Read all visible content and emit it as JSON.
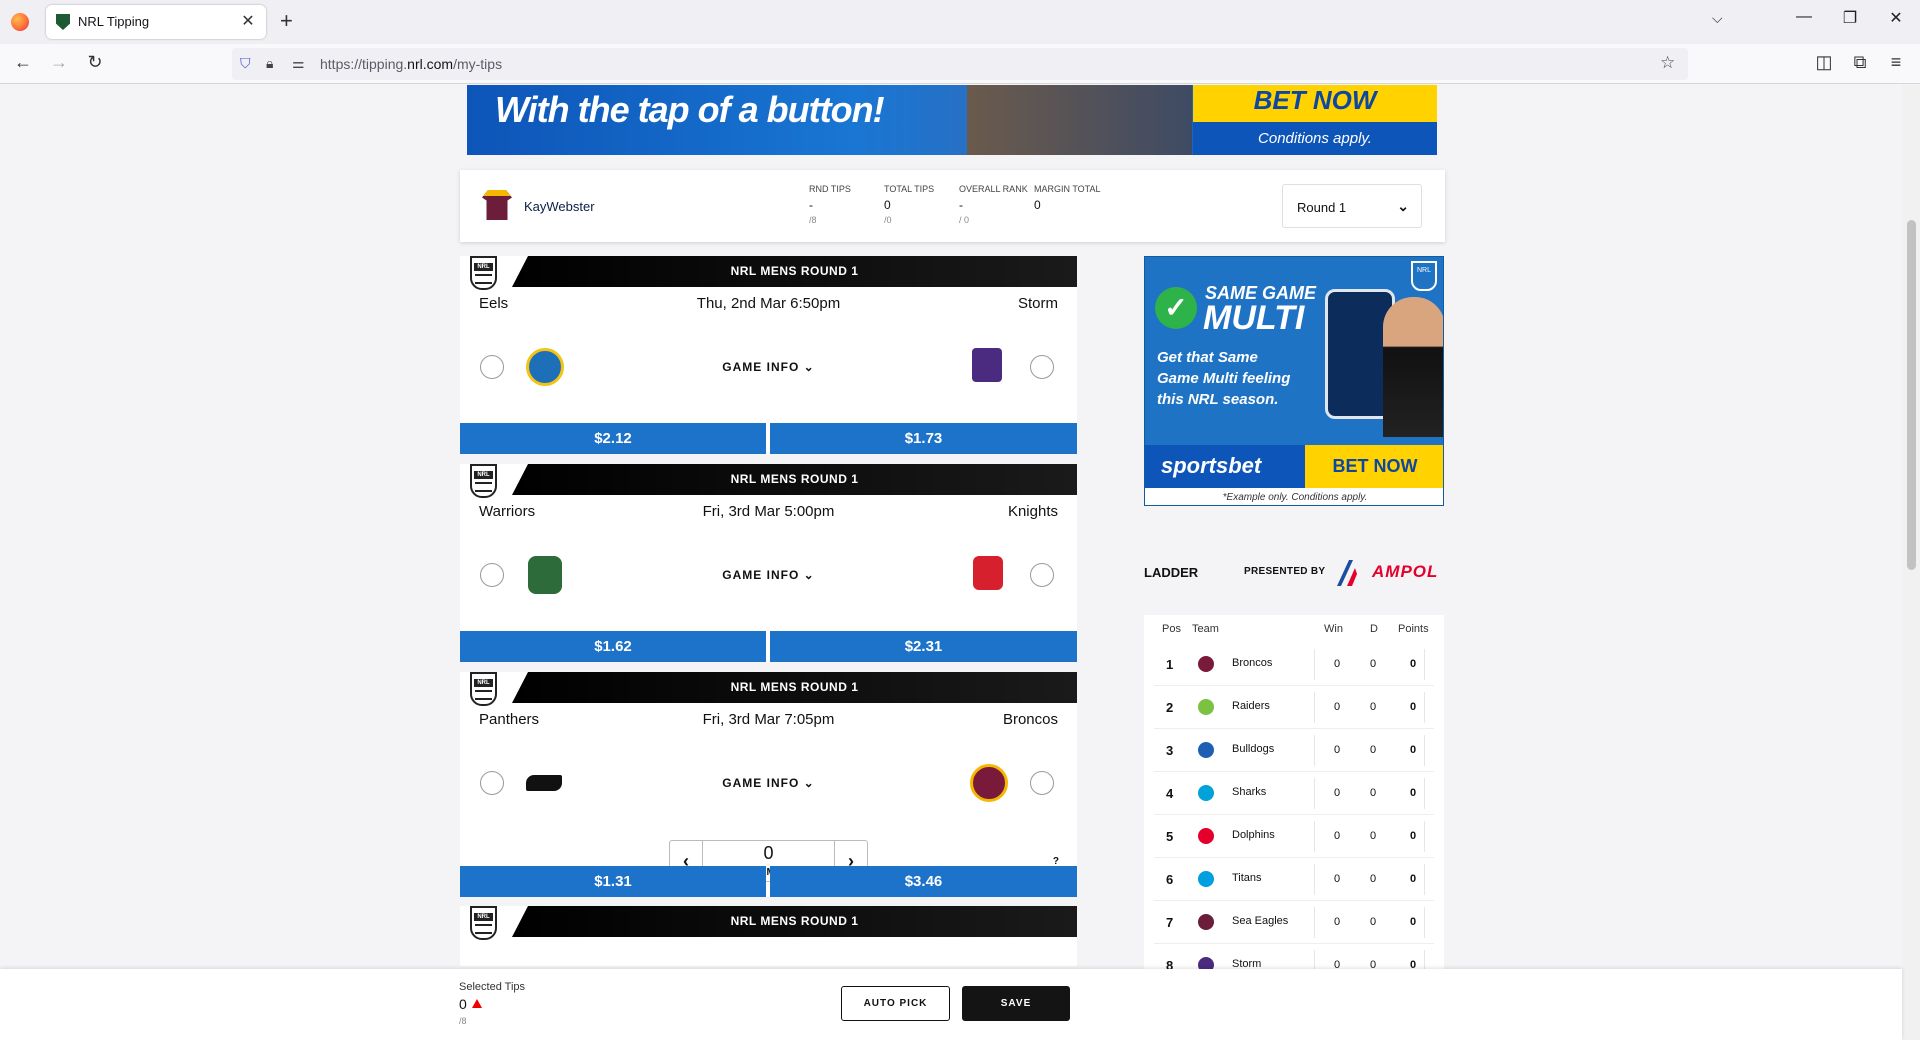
{
  "browser": {
    "tab_title": "NRL Tipping",
    "url_prefix": "https://tipping.",
    "url_domain": "nrl.com",
    "url_path": "/my-tips"
  },
  "banner": {
    "tagline": "With the tap of a button!",
    "cta": "BET NOW",
    "conditions": "Conditions apply."
  },
  "user": {
    "name": "KayWebster",
    "stats": [
      {
        "label": "RND TIPS",
        "value": "-",
        "sub": "/8"
      },
      {
        "label": "TOTAL TIPS",
        "value": "0",
        "sub": "/0"
      },
      {
        "label": "OVERALL RANK",
        "value": "-",
        "sub": "/ 0"
      },
      {
        "label": "MARGIN TOTAL",
        "value": "0",
        "sub": ""
      }
    ],
    "round": "Round 1"
  },
  "matches": [
    {
      "header": "NRL MENS ROUND 1",
      "home": "Eels",
      "away": "Storm",
      "kickoff": "Thu, 2nd Mar 6:50pm",
      "game_info": "GAME INFO",
      "home_odds": "$2.12",
      "away_odds": "$1.73",
      "home_color": "#1d6fb8",
      "away_color": "#4b2b7f"
    },
    {
      "header": "NRL MENS ROUND 1",
      "home": "Warriors",
      "away": "Knights",
      "kickoff": "Fri, 3rd Mar 5:00pm",
      "game_info": "GAME INFO",
      "home_odds": "$1.62",
      "away_odds": "$2.31",
      "home_color": "#2e6b3a",
      "away_color": "#d6202e"
    },
    {
      "header": "NRL MENS ROUND 1",
      "home": "Panthers",
      "away": "Broncos",
      "kickoff": "Fri, 3rd Mar 7:05pm",
      "game_info": "GAME INFO",
      "home_odds": "$1.31",
      "away_odds": "$3.46",
      "home_color": "#111111",
      "away_color": "#7a1a3a",
      "margin": "0",
      "margin_label": "ENTER MARGIN",
      "help": "?"
    },
    {
      "header": "NRL MENS ROUND 1"
    }
  ],
  "side_ad": {
    "line1": "SAME GAME",
    "line2": "MULTI",
    "text": "Get that Same Game Multi feeling this NRL season.",
    "brand": "sportsbet",
    "cta": "BET NOW",
    "conditions": "*Example only. Conditions apply."
  },
  "ladder": {
    "title": "LADDER",
    "presented_by": "PRESENTED BY",
    "sponsor": "AMPOL",
    "columns": {
      "pos": "Pos",
      "team": "Team",
      "win": "Win",
      "d": "D",
      "points": "Points"
    },
    "rows": [
      {
        "pos": "1",
        "team": "Broncos",
        "win": "0",
        "d": "0",
        "points": "0",
        "color": "#7a1a3a"
      },
      {
        "pos": "2",
        "team": "Raiders",
        "win": "0",
        "d": "0",
        "points": "0",
        "color": "#7bc142"
      },
      {
        "pos": "3",
        "team": "Bulldogs",
        "win": "0",
        "d": "0",
        "points": "0",
        "color": "#1e5fb4"
      },
      {
        "pos": "4",
        "team": "Sharks",
        "win": "0",
        "d": "0",
        "points": "0",
        "color": "#00a3d9"
      },
      {
        "pos": "5",
        "team": "Dolphins",
        "win": "0",
        "d": "0",
        "points": "0",
        "color": "#e4002b"
      },
      {
        "pos": "6",
        "team": "Titans",
        "win": "0",
        "d": "0",
        "points": "0",
        "color": "#009fdf"
      },
      {
        "pos": "7",
        "team": "Sea Eagles",
        "win": "0",
        "d": "0",
        "points": "0",
        "color": "#6b1d3a"
      },
      {
        "pos": "8",
        "team": "Storm",
        "win": "0",
        "d": "0",
        "points": "0",
        "color": "#4b2b7f"
      }
    ]
  },
  "footer": {
    "selected_label": "Selected Tips",
    "selected_value": "0",
    "selected_sub": "/8",
    "auto_pick": "AUTO PICK",
    "save": "SAVE"
  }
}
